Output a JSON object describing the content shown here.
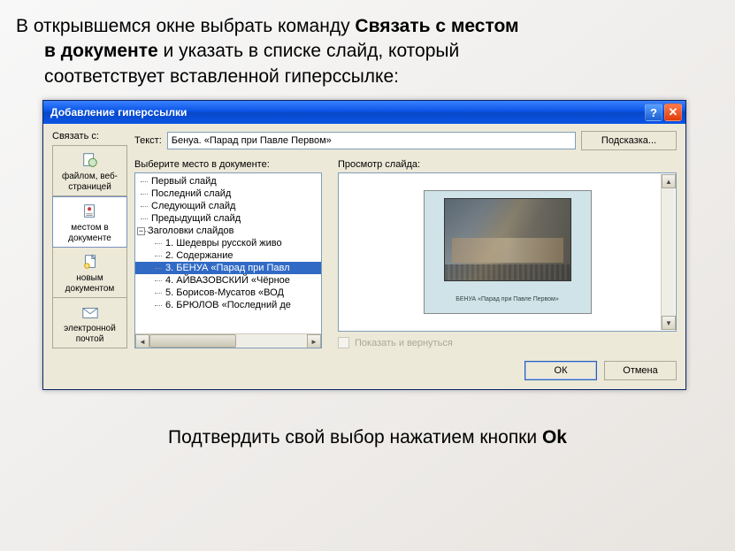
{
  "instruction": {
    "line1_prefix": "В открывшемся окне выбрать команду ",
    "line1_bold": "Связать с местом",
    "line2_bold": "в документе",
    "line2_suffix": " и указать в списке слайд, который",
    "line3": "соответствует вставленной гиперссылке:"
  },
  "dialog": {
    "title": "Добавление гиперссылки",
    "link_with_label": "Связать с:",
    "text_label": "Текст:",
    "text_value": "Бенуа. «Парад при Павле Первом»",
    "tooltip_button": "Подсказка...",
    "select_place_label": "Выберите место в документе:",
    "preview_label": "Просмотр слайда:",
    "show_return_label": "Показать и вернуться",
    "link_buttons": {
      "file_web": "файлом, веб-страницей",
      "place_in_doc": "местом в документе",
      "new_doc": "новым документом",
      "email": "электронной почтой"
    },
    "tree": {
      "first_slide": "Первый слайд",
      "last_slide": "Последний слайд",
      "next_slide": "Следующий слайд",
      "prev_slide": "Предыдущий слайд",
      "headings": "Заголовки слайдов",
      "items": {
        "0": "1. Шедевры  русской живо",
        "1": "2. Содержание",
        "2": "3. БЕНУА «Парад при Павл",
        "3": "4. АЙВАЗОВСКИЙ «Чёрное",
        "4": "5. Борисов-Мусатов «ВОД",
        "5": "6. БРЮЛОВ «Последний де"
      }
    },
    "slide_caption": "БЕНУА «Парад при Павле Первом»",
    "ok_button": "ОК",
    "cancel_button": "Отмена",
    "help_glyph": "?",
    "close_glyph": "✕"
  },
  "instruction_bottom": {
    "prefix": "Подтвердить свой выбор нажатием кнопки ",
    "bold": "Ok"
  }
}
